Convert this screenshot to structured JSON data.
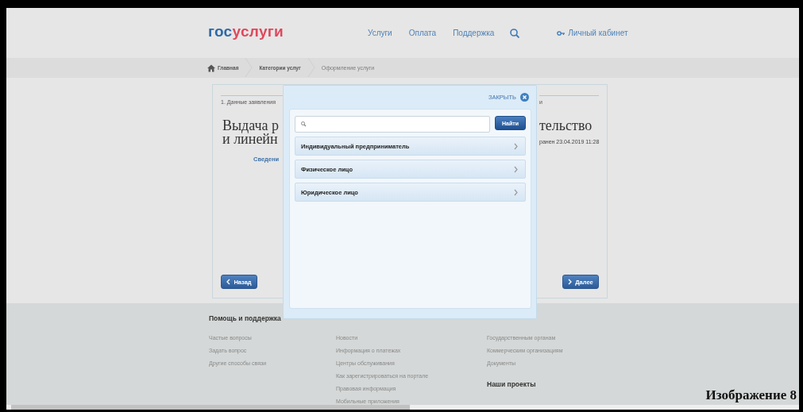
{
  "header": {
    "logo": {
      "first": "гос",
      "second": "услуги"
    },
    "nav": [
      "Услуги",
      "Оплата",
      "Поддержка"
    ],
    "account": "Личный кабинет"
  },
  "breadcrumbs": [
    {
      "label": "Главная",
      "kind": "home",
      "current": false
    },
    {
      "label": "Категории услуг",
      "kind": "link",
      "current": false
    },
    {
      "label": "Оформление услуги",
      "kind": "link",
      "current": true
    }
  ],
  "card": {
    "left": {
      "step": "1. Данные заявления",
      "title_lines": [
        "Выдача р",
        "и линейн"
      ],
      "link": "Сведени"
    },
    "right": {
      "step": "и",
      "title_lines": [
        "тельство"
      ],
      "saved": "ранен 23.04.2019 11:28"
    },
    "buttons": [
      {
        "label": "Назад",
        "kind": "back"
      },
      {
        "label": "Далее",
        "kind": "next"
      }
    ]
  },
  "modal": {
    "close": "ЗАКРЫТЬ",
    "search_button": "Найти",
    "items": [
      "Индивидуальный предприниматель",
      "Физическое лицо",
      "Юридическое лицо"
    ]
  },
  "footer": {
    "heading": "Помощь и поддержка",
    "columns": [
      [
        "Частые вопросы",
        "Задать вопрос",
        "Другие способы связи"
      ],
      [
        "Новости",
        "Информация о платежах",
        "Центры обслуживания",
        "Как зарегистрироваться на портале",
        "Правовая информация",
        "Мобильные приложения"
      ],
      [
        "Государственным органам",
        "Коммерческим организациям",
        "Документы"
      ]
    ],
    "projects_heading": "Наши проекты"
  },
  "caption": "Изображение 8"
}
